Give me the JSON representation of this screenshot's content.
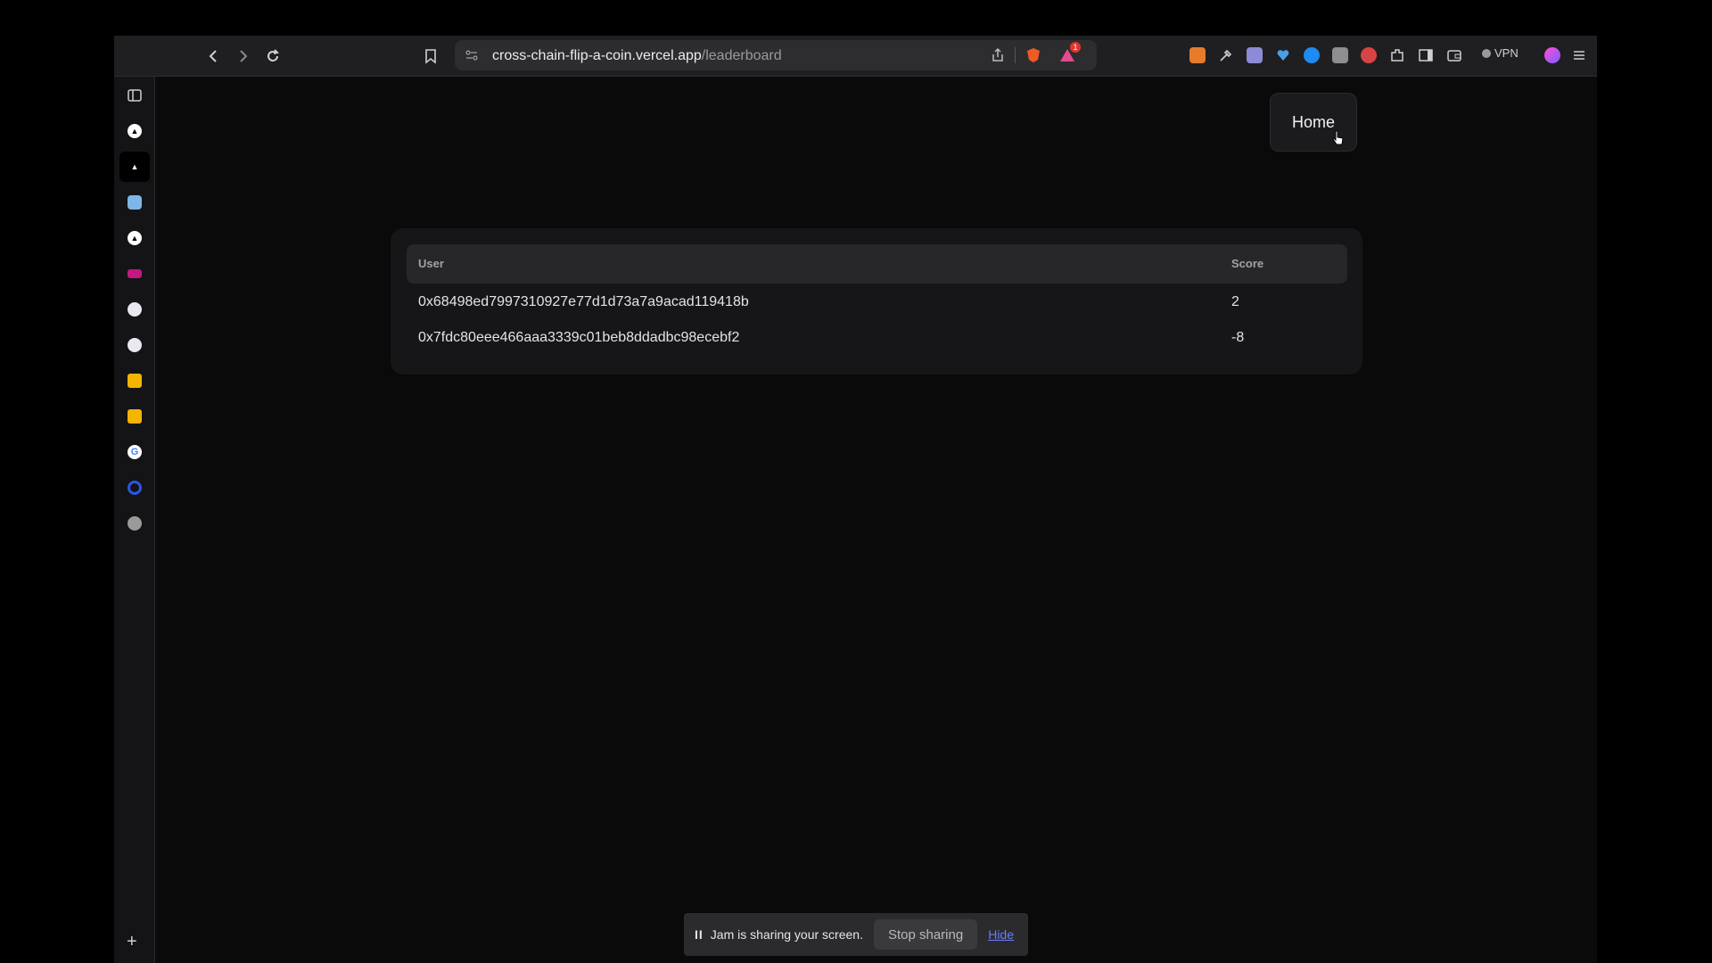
{
  "browser": {
    "url_host": "cross-chain-flip-a-coin.vercel.app",
    "url_path": "/leaderboard",
    "brave_badge": "1",
    "vpn_label": "VPN"
  },
  "page": {
    "home_label": "Home",
    "table": {
      "headers": {
        "user": "User",
        "score": "Score"
      },
      "rows": [
        {
          "user": "0x68498ed7997310927e77d1d73a7a9acad119418b",
          "score": "2"
        },
        {
          "user": "0x7fdc80eee466aaa3339c01beb8ddadbc98ecebf2",
          "score": "-8"
        }
      ]
    }
  },
  "share_bar": {
    "pause_glyph": "II",
    "message": "Jam is sharing your screen.",
    "stop_label": "Stop sharing",
    "hide_label": "Hide"
  },
  "sidebar_icons": [
    "sidebar-toggle-icon",
    "triangle-app-icon",
    "triangle-app-icon",
    "ghost-app-icon",
    "triangle-app-icon",
    "pink-app-icon",
    "chain-app-icon",
    "chain-app-icon",
    "yellow-slides-icon",
    "yellow-slides-icon",
    "google-icon",
    "blue-ring-icon",
    "globe-icon",
    "add-icon"
  ],
  "colors": {
    "accent_link": "#6b7cff"
  }
}
